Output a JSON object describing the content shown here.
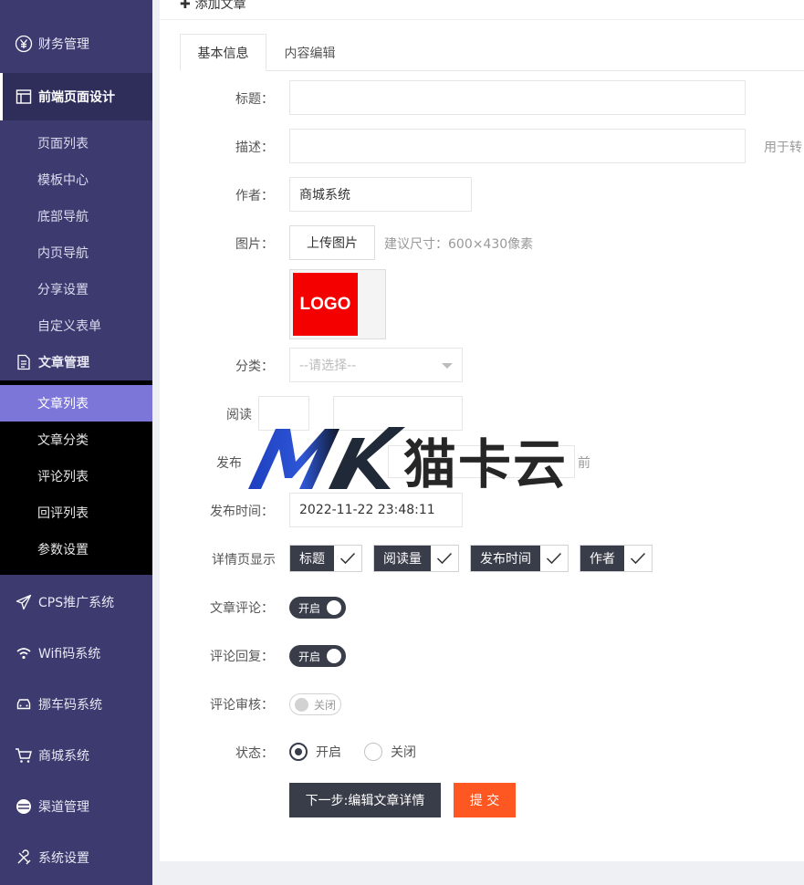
{
  "sidebar": {
    "top_item": {
      "label": "财务管理",
      "icon": "yen-circle-icon"
    },
    "frontend_group": {
      "label": "前端页面设计",
      "icon": "layout-icon"
    },
    "frontend_items": [
      "页面列表",
      "模板中心",
      "底部导航",
      "内页导航",
      "分享设置",
      "自定义表单"
    ],
    "article_group": {
      "label": "文章管理",
      "icon": "document-icon"
    },
    "article_items": [
      "文章列表",
      "文章分类",
      "评论列表",
      "回评列表",
      "参数设置"
    ],
    "active_item": "文章列表",
    "bottom_items": [
      {
        "label": "CPS推广系统",
        "icon": "paper-plane-icon"
      },
      {
        "label": "Wifi码系统",
        "icon": "wifi-icon"
      },
      {
        "label": "挪车码系统",
        "icon": "car-icon"
      },
      {
        "label": "商城系统",
        "icon": "cart-icon"
      },
      {
        "label": "渠道管理",
        "icon": "channel-icon"
      },
      {
        "label": "系统设置",
        "icon": "tools-icon"
      }
    ]
  },
  "header": {
    "title": "添加文章"
  },
  "tabs": [
    "基本信息",
    "内容编辑"
  ],
  "form": {
    "title_label": "标题：",
    "title_value": "",
    "desc_label": "描述：",
    "desc_value": "",
    "desc_hint": "用于转",
    "author_label": "作者：",
    "author_value": "商城系统",
    "image_label": "图片：",
    "upload_label": "上传图片",
    "image_hint": "建议尺寸：600×430像素",
    "logo_text": "LOGO",
    "category_label": "分类：",
    "category_placeholder": "--请选择--",
    "read_label": "阅读",
    "publish_partial_label": "发布",
    "publish_partial_hint": "前",
    "publish_time_label": "发布时间：",
    "publish_time_value": "2022-11-22 23:48:11",
    "detail_label": "详情页显示",
    "detail_chips": [
      "标题",
      "阅读量",
      "发布时间",
      "作者"
    ],
    "comment_label": "文章评论：",
    "comment_switch": "开启",
    "reply_label": "评论回复：",
    "reply_switch": "开启",
    "review_label": "评论审核：",
    "review_switch": "关闭",
    "status_label": "状态：",
    "status_options": [
      "开启",
      "关闭"
    ],
    "status_selected": "开启",
    "next_button": "下一步:编辑文章详情",
    "submit_button": "提 交"
  },
  "watermark": {
    "text": "猫卡云"
  },
  "colors": {
    "sidebar": "#3c3a6e",
    "active": "#7b76d8",
    "dark": "#393d49",
    "orange": "#ff5722",
    "logo_red": "#f50000"
  }
}
